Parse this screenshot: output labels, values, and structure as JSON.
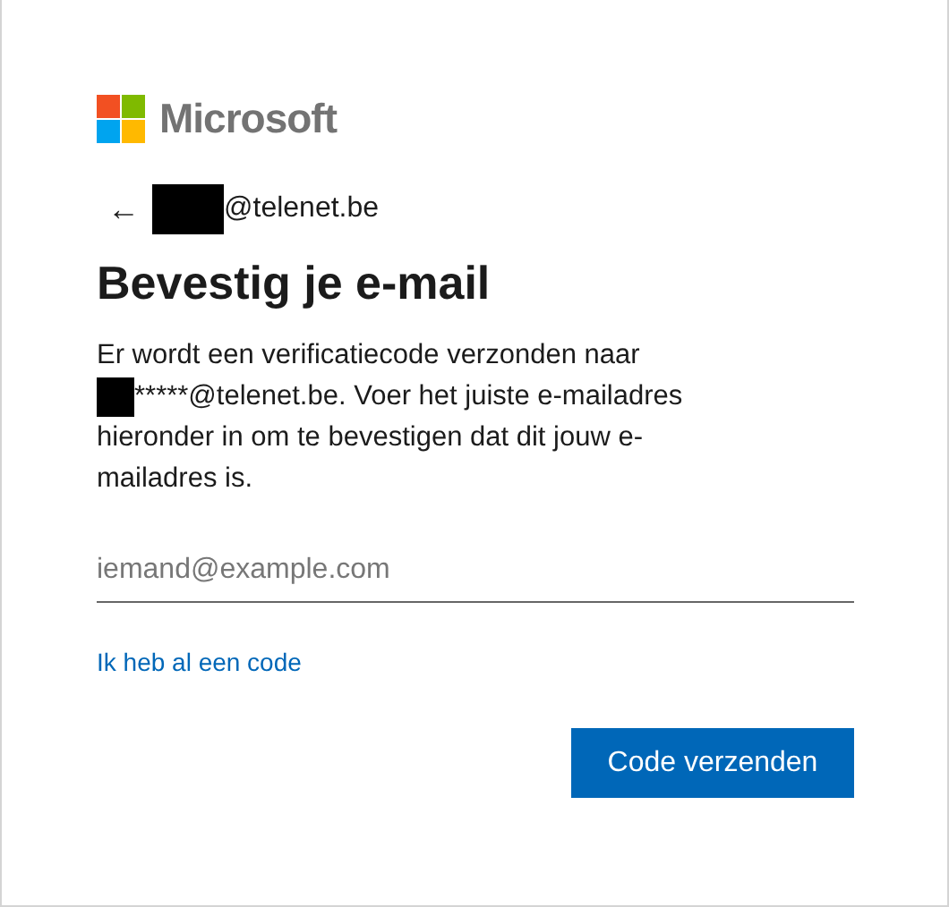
{
  "logo": {
    "text": "Microsoft"
  },
  "identity": {
    "arrow": "←",
    "email": "@telenet.be"
  },
  "title": "Bevestig je e-mail",
  "description": [
    {
      "kind": "text",
      "text": "Er wordt een verificatiecode verzonden naar"
    },
    {
      "kind": "redacted",
      "text": "*****@telenet.be. Voer het juiste e-mailadres"
    },
    {
      "kind": "text",
      "text": "hieronder in om te bevestigen dat dit jouw e-"
    },
    {
      "kind": "text",
      "text": "mailadres is."
    }
  ],
  "email_field": {
    "placeholder": "iemand@example.com"
  },
  "link": "Ik heb al een code",
  "buttons": [
    "Code verzenden"
  ]
}
